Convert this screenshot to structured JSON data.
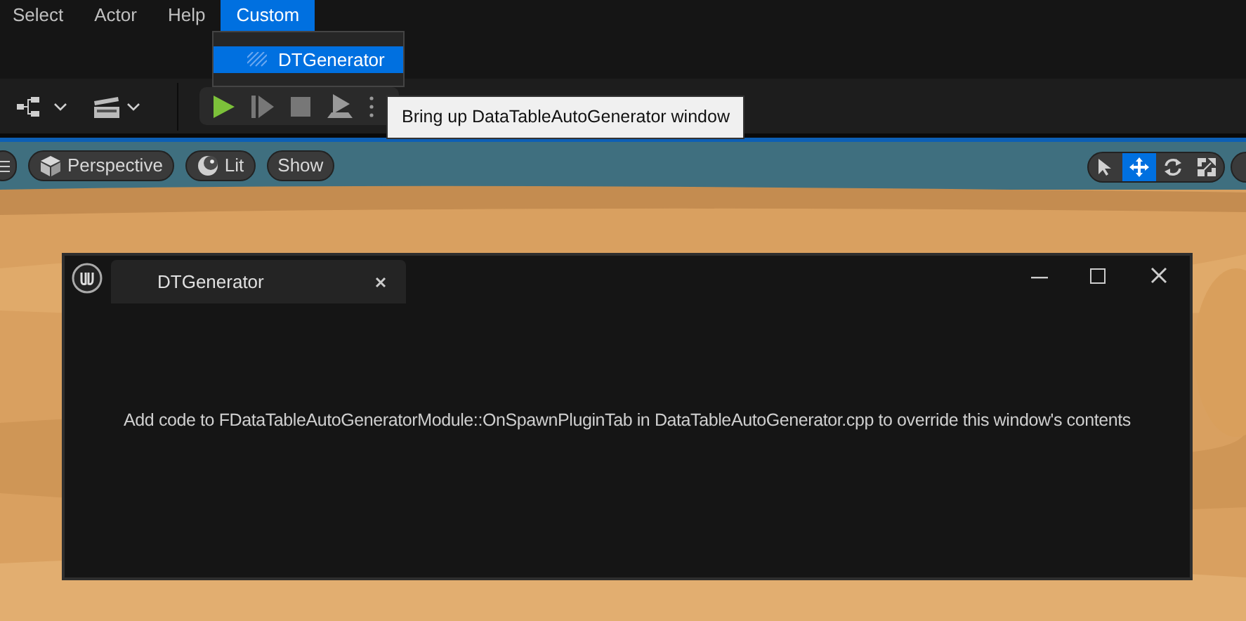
{
  "menu_bar": {
    "items": [
      {
        "label": "Select",
        "selected": false
      },
      {
        "label": "Actor",
        "selected": false
      },
      {
        "label": "Help",
        "selected": false
      },
      {
        "label": "Custom",
        "selected": true
      }
    ]
  },
  "dropdown": {
    "items": [
      {
        "label": "DTGenerator",
        "selected": true
      }
    ]
  },
  "tooltip": {
    "text": "Bring up DataTableAutoGenerator window"
  },
  "viewport_toolbar": {
    "buttons": [
      {
        "label": "Perspective",
        "kind": "cube"
      },
      {
        "label": "Lit",
        "kind": "sphere"
      },
      {
        "label": "Show",
        "kind": "plain"
      }
    ],
    "tools": [
      {
        "kind": "select",
        "selected": false
      },
      {
        "kind": "move",
        "selected": true
      },
      {
        "kind": "rotate",
        "selected": false
      },
      {
        "kind": "scale",
        "selected": false
      }
    ]
  },
  "window": {
    "tab": {
      "title": "DTGenerator"
    },
    "message": "Add code to FDataTableAutoGeneratorModule::OnSpawnPluginTab in DataTableAutoGenerator.cpp to override this window's contents"
  }
}
